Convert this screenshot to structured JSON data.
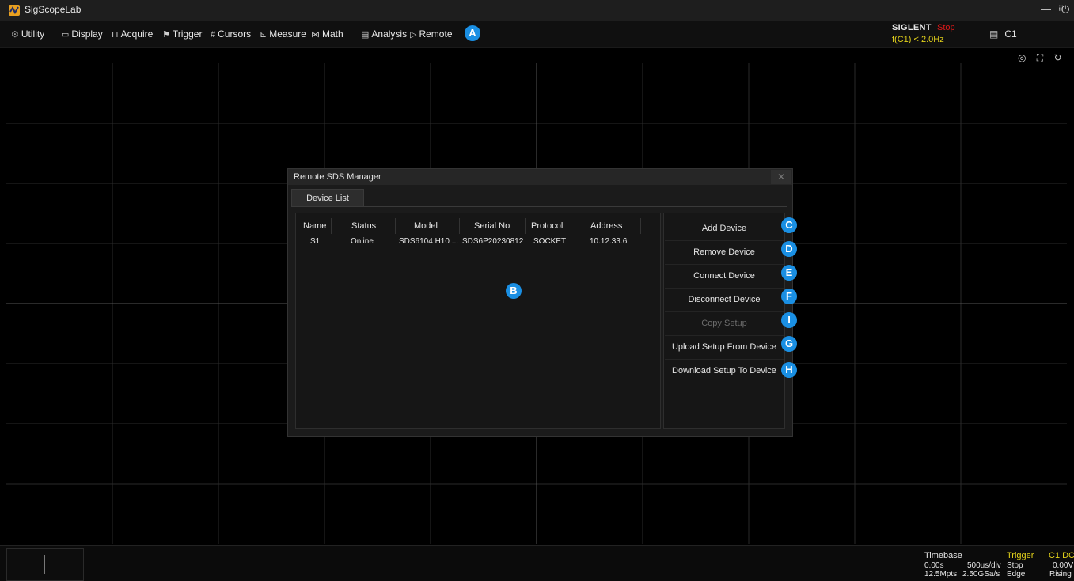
{
  "app": {
    "title": "SigScopeLab"
  },
  "window_controls": {
    "minimize": "—",
    "restore": "⁝⁝",
    "power": "⏻"
  },
  "menu": [
    {
      "label": "Utility",
      "icon": "⚙"
    },
    {
      "label": "Display",
      "icon": "▭"
    },
    {
      "label": "Acquire",
      "icon": "⊓"
    },
    {
      "label": "Trigger",
      "icon": "⚑"
    },
    {
      "label": "Cursors",
      "icon": "#"
    },
    {
      "label": "Measure",
      "icon": "⊾"
    },
    {
      "label": "Math",
      "icon": "⋈"
    },
    {
      "label": "Analysis",
      "icon": "▤"
    },
    {
      "label": "Remote",
      "icon": "▷"
    }
  ],
  "status": {
    "brand": "SIGLENT",
    "run_state": "Stop",
    "trigger_readout": "f(C1) < 2.0Hz",
    "channel": "C1",
    "channel_icon": "▤"
  },
  "toolbar_icons": "◎ ⛶ ↻",
  "dialog": {
    "title": "Remote SDS Manager",
    "close": "✕",
    "tab": "Device List",
    "columns": [
      "Name",
      "Status",
      "Model",
      "Serial No",
      "Protocol",
      "Address"
    ],
    "rows": [
      [
        "S1",
        "Online",
        "SDS6104 H10 ...",
        "SDS6P20230812",
        "SOCKET",
        "10.12.33.6"
      ]
    ],
    "buttons": [
      "Add Device",
      "Remove Device",
      "Connect Device",
      "Disconnect Device",
      "Copy Setup",
      "Upload Setup From Device",
      "Download Setup To Device"
    ]
  },
  "callouts": {
    "a": "A",
    "b": "B",
    "c": "C",
    "d": "D",
    "e": "E",
    "f": "F",
    "i": "I",
    "g": "G",
    "h": "H"
  },
  "bottom": {
    "timebase": {
      "title": "Timebase",
      "delay": "0.00s",
      "scale": "500us/div",
      "memory": "12.5Mpts",
      "rate": "2.50GSa/s"
    },
    "trigger": {
      "title": "Trigger",
      "mode": "Stop",
      "type": "Edge"
    },
    "channel": {
      "title": "C1 DC",
      "level": "0.00V",
      "slope": "Rising"
    }
  },
  "colors": {
    "accent": "#1a8fe3",
    "stop": "#e01919",
    "trigger_yellow": "#e2d11b"
  }
}
